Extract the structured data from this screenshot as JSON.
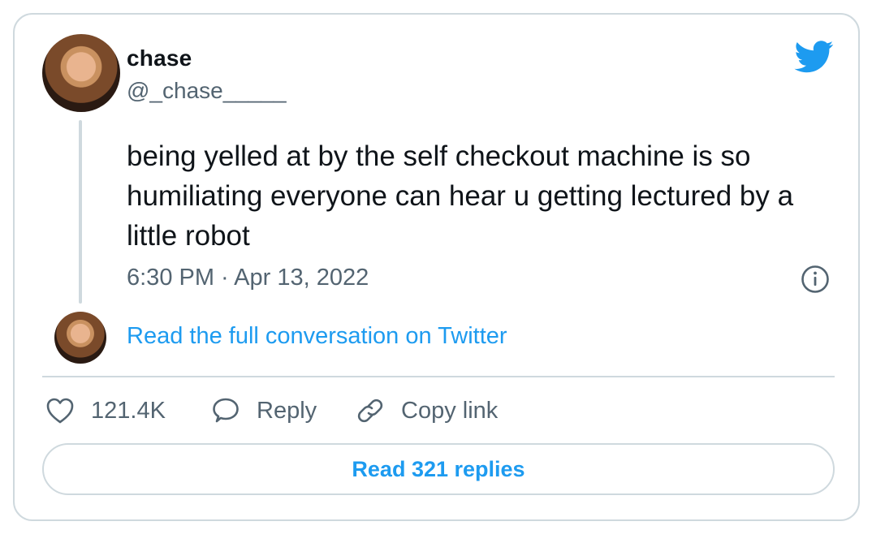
{
  "author": {
    "name": "chase",
    "handle": "@_chase_____"
  },
  "tweet": {
    "text": "being yelled at by the self checkout machine is so humiliating everyone can hear u getting lectured by a little robot",
    "timestamp": "6:30 PM · Apr 13, 2022"
  },
  "conversation_link": "Read the full conversation on Twitter",
  "actions": {
    "like_count": "121.4K",
    "reply_label": "Reply",
    "copy_link_label": "Copy link"
  },
  "read_replies_label": "Read 321 replies",
  "icons": {
    "brand": "twitter-bird-icon",
    "info": "info-icon",
    "like": "heart-icon",
    "reply": "speech-bubble-icon",
    "copy": "link-icon"
  },
  "colors": {
    "accent": "#1d9bf0",
    "text": "#0f1419",
    "muted": "#536471",
    "border": "#cfd9de"
  }
}
